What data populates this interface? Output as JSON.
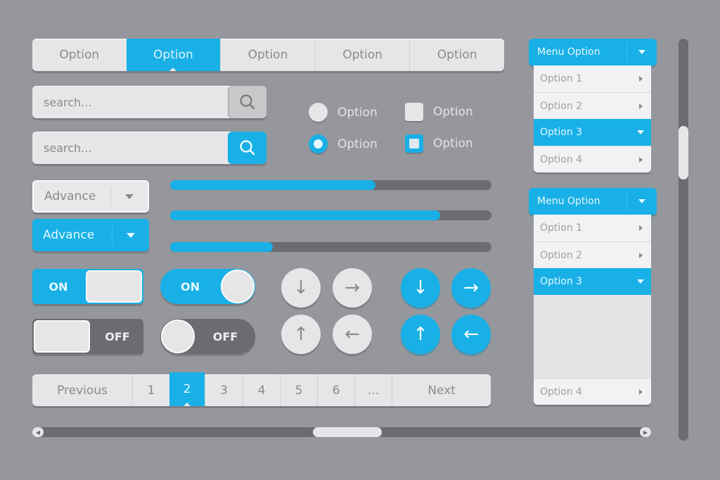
{
  "colors": {
    "accent": "#18b0e6",
    "background": "#96979c",
    "surface": "#e6e6e8",
    "track": "#6b6c71"
  },
  "tabs": {
    "items": [
      {
        "label": "Option",
        "active": false
      },
      {
        "label": "Option",
        "active": true
      },
      {
        "label": "Option",
        "active": false
      },
      {
        "label": "Option",
        "active": false
      },
      {
        "label": "Option",
        "active": false
      }
    ]
  },
  "search": [
    {
      "placeholder": "search...",
      "value": "",
      "button_style": "grey",
      "icon": "search-icon"
    },
    {
      "placeholder": "search...",
      "value": "",
      "button_style": "blue",
      "icon": "search-icon"
    }
  ],
  "choices": {
    "radios": [
      {
        "label": "Option",
        "checked": false
      },
      {
        "label": "Option",
        "checked": true
      }
    ],
    "checkboxes": [
      {
        "label": "Option",
        "checked": false
      },
      {
        "label": "Option",
        "checked": true
      }
    ]
  },
  "selects": [
    {
      "value": "Advance",
      "style": "light"
    },
    {
      "value": "Advance",
      "style": "blue"
    }
  ],
  "progress": [
    {
      "value": 0.64
    },
    {
      "value": 0.84
    },
    {
      "value": 0.32
    }
  ],
  "toggles": [
    {
      "label": "ON",
      "state": "on",
      "shape": "rect"
    },
    {
      "label": "ON",
      "state": "on",
      "shape": "pill"
    },
    {
      "label": "OFF",
      "state": "off",
      "shape": "rect"
    },
    {
      "label": "OFF",
      "state": "off",
      "shape": "pill"
    }
  ],
  "arrow_buttons": {
    "grey": [
      {
        "icon": "arrow-down-icon",
        "glyph": "↓"
      },
      {
        "icon": "arrow-right-icon",
        "glyph": "→"
      },
      {
        "icon": "arrow-up-icon",
        "glyph": "↑"
      },
      {
        "icon": "arrow-left-icon",
        "glyph": "←"
      }
    ],
    "blue": [
      {
        "icon": "arrow-down-icon",
        "glyph": "↓"
      },
      {
        "icon": "arrow-right-icon",
        "glyph": "→"
      },
      {
        "icon": "arrow-up-icon",
        "glyph": "↑"
      },
      {
        "icon": "arrow-left-icon",
        "glyph": "←"
      }
    ]
  },
  "pagination": {
    "previous_label": "Previous",
    "next_label": "Next",
    "pages": [
      "1",
      "2",
      "3",
      "4",
      "5",
      "6",
      "..."
    ],
    "current_page": "2"
  },
  "scrollbars": {
    "horizontal": {
      "position": 0.51
    },
    "vertical": {
      "position": 0.25
    }
  },
  "menus": [
    {
      "title": "Menu Option",
      "items": [
        {
          "label": "Option 1",
          "active": false
        },
        {
          "label": "Option 2",
          "active": false
        },
        {
          "label": "Option 3",
          "active": true
        },
        {
          "label": "Option 4",
          "active": false
        }
      ],
      "expanded": false
    },
    {
      "title": "Menu Option",
      "items": [
        {
          "label": "Option 1",
          "active": false
        },
        {
          "label": "Option 2",
          "active": false
        },
        {
          "label": "Option 3",
          "active": true
        },
        {
          "label": "Option 4",
          "active": false
        }
      ],
      "expanded": true
    }
  ]
}
